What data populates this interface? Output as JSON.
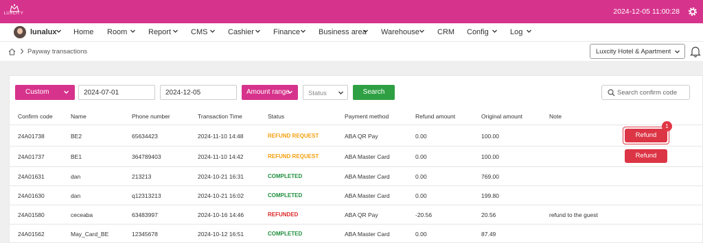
{
  "brand": {
    "logo_text": "LUXCITY",
    "accent_color": "#d6338c"
  },
  "topbar": {
    "datetime": "2024-12-05 11:00:28",
    "settings_icon": "gear-icon"
  },
  "menu": {
    "user": "lunalux",
    "items": [
      {
        "label": "Home",
        "dropdown": false
      },
      {
        "label": "Room",
        "dropdown": true
      },
      {
        "label": "Report",
        "dropdown": true
      },
      {
        "label": "CMS",
        "dropdown": true
      },
      {
        "label": "Cashier",
        "dropdown": true
      },
      {
        "label": "Finance",
        "dropdown": true
      },
      {
        "label": "Business area",
        "dropdown": true
      },
      {
        "label": "Warehouse",
        "dropdown": true
      },
      {
        "label": "CRM",
        "dropdown": false
      },
      {
        "label": "Config",
        "dropdown": true
      },
      {
        "label": "Log",
        "dropdown": true
      }
    ]
  },
  "breadcrumb": {
    "current": "Payway transactions"
  },
  "hotel_selector": {
    "value": "Luxcity Hotel & Apartment"
  },
  "filters": {
    "period": "Custom",
    "from_date": "2024-07-01",
    "to_date": "2024-12-05",
    "amount_range": "Amount range",
    "status_placeholder": "Status",
    "search_label": "Search",
    "code_search_placeholder": "Search confirm code"
  },
  "table": {
    "headers": [
      "Confirm code",
      "Name",
      "Phone number",
      "Transaction Time",
      "Status",
      "Payment method",
      "Refund amount",
      "Original amount",
      "Note"
    ],
    "rows": [
      {
        "code": "24A01738",
        "name": "BE2",
        "phone": "65634423",
        "time": "2024-11-10 14:48",
        "status": "REFUND REQUEST",
        "method": "ABA QR Pay",
        "refund": "0.00",
        "original": "100.00",
        "note": "",
        "action": "Refund"
      },
      {
        "code": "24A01737",
        "name": "BE1",
        "phone": "364789403",
        "time": "2024-11-10 14:42",
        "status": "REFUND REQUEST",
        "method": "ABA Master Card",
        "refund": "0.00",
        "original": "100.00",
        "note": "",
        "action": "Refund"
      },
      {
        "code": "24A01631",
        "name": "dan",
        "phone": "213213",
        "time": "2024-10-21 16:31",
        "status": "COMPLETED",
        "method": "ABA Master Card",
        "refund": "0.00",
        "original": "769.00",
        "note": "",
        "action": ""
      },
      {
        "code": "24A01630",
        "name": "dan",
        "phone": "q12313213",
        "time": "2024-10-21 16:02",
        "status": "COMPLETED",
        "method": "ABA Master Card",
        "refund": "0.00",
        "original": "199.80",
        "note": "",
        "action": ""
      },
      {
        "code": "24A01580",
        "name": "ceceaba",
        "phone": "63483997",
        "time": "2024-10-16 14:46",
        "status": "REFUNDED",
        "method": "ABA QR Pay",
        "refund": "-20.56",
        "original": "20.56",
        "note": "refund to the guest",
        "action": ""
      },
      {
        "code": "24A01562",
        "name": "May_Card_BE",
        "phone": "12345678",
        "time": "2024-10-12 16:51",
        "status": "COMPLETED",
        "method": "ABA Master Card",
        "refund": "0.00",
        "original": "87.49",
        "note": "",
        "action": ""
      }
    ]
  },
  "annotation": {
    "badge_number": "1"
  }
}
